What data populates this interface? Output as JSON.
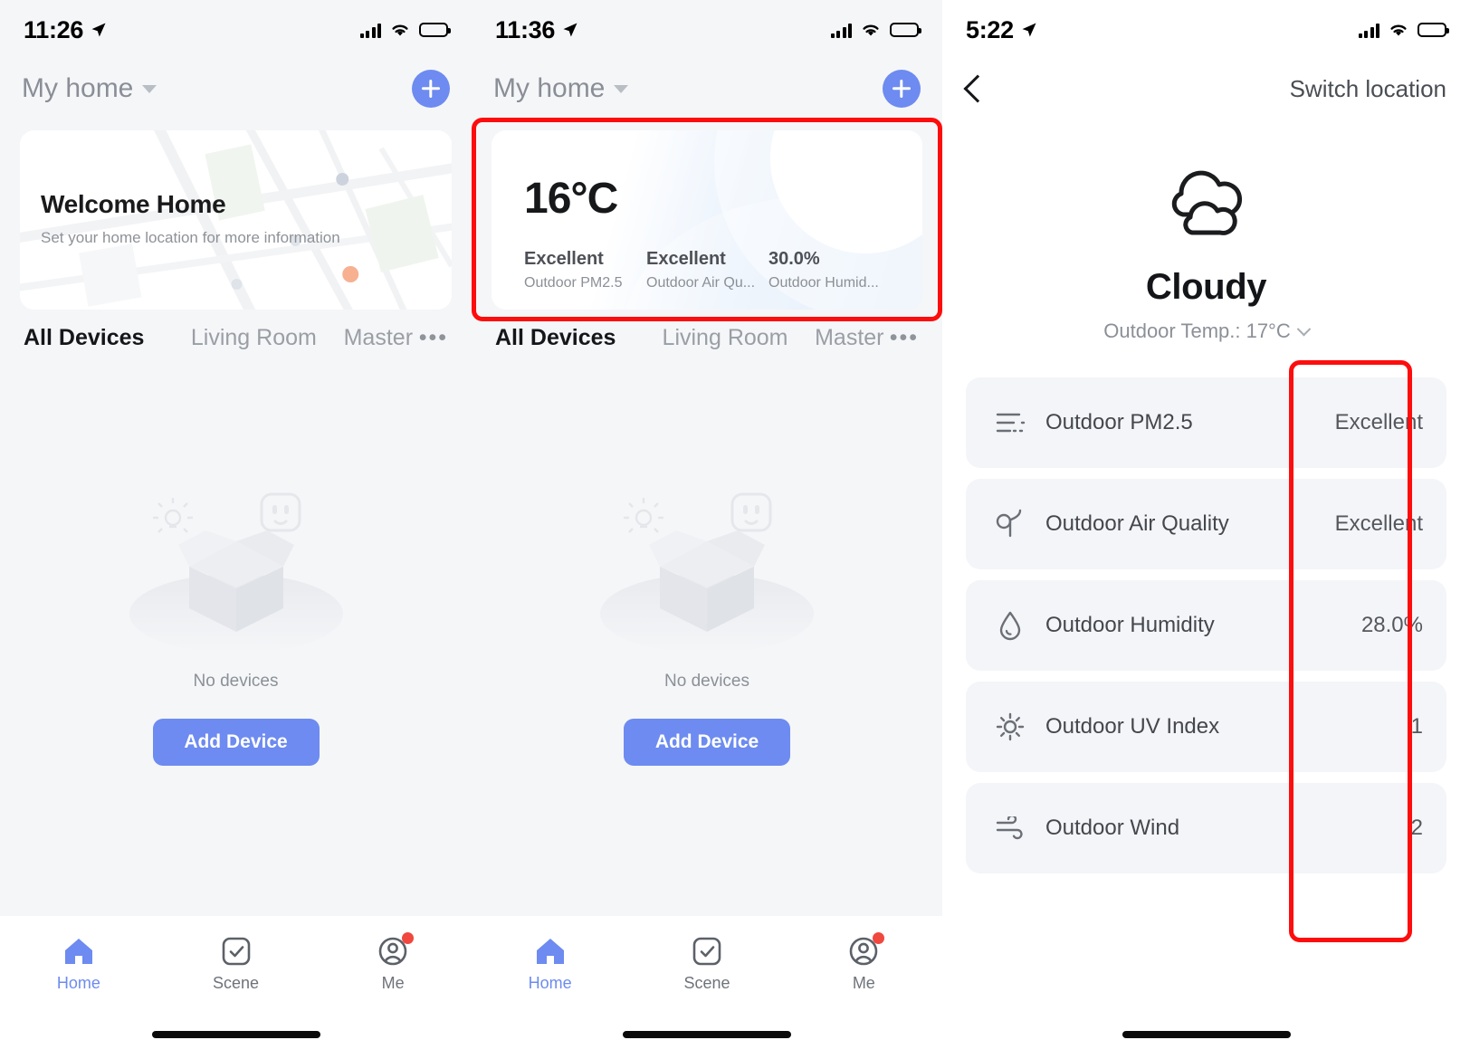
{
  "panel1": {
    "status": {
      "time": "11:26",
      "location_icon": "location-arrow-icon",
      "cellular_icon": "cellular-bars-icon",
      "wifi_icon": "wifi-icon",
      "battery_icon": "battery-icon"
    },
    "header": {
      "home_name": "My home",
      "caret_icon": "chevron-down-icon",
      "add_icon": "plus-icon"
    },
    "welcome": {
      "title": "Welcome Home",
      "subtitle": "Set your home location for more information"
    },
    "tabs": [
      {
        "label": "All Devices",
        "active": true
      },
      {
        "label": "Living Room",
        "active": false
      },
      {
        "label": "Master Be",
        "active": false
      }
    ],
    "tabs_overflow": "•••",
    "empty": {
      "message": "No devices",
      "button": "Add Device"
    },
    "tabbar": [
      {
        "label": "Home",
        "icon": "home-icon",
        "active": true,
        "badge": false
      },
      {
        "label": "Scene",
        "icon": "checkbox-icon",
        "active": false,
        "badge": false
      },
      {
        "label": "Me",
        "icon": "account-icon",
        "active": false,
        "badge": true
      }
    ]
  },
  "panel2": {
    "status": {
      "time": "11:36",
      "location_icon": "location-arrow-icon"
    },
    "header": {
      "home_name": "My home",
      "caret_icon": "chevron-down-icon",
      "add_icon": "plus-icon"
    },
    "weather_card": {
      "temperature": "16°C",
      "metrics": [
        {
          "value": "Excellent",
          "label": "Outdoor PM2.5"
        },
        {
          "value": "Excellent",
          "label": "Outdoor Air Qu..."
        },
        {
          "value": "30.0%",
          "label": "Outdoor Humid..."
        }
      ]
    },
    "tabs": [
      {
        "label": "All Devices",
        "active": true
      },
      {
        "label": "Living Room",
        "active": false
      },
      {
        "label": "Master Be",
        "active": false
      }
    ],
    "tabs_overflow": "•••",
    "empty": {
      "message": "No devices",
      "button": "Add Device"
    },
    "tabbar": [
      {
        "label": "Home",
        "icon": "home-icon",
        "active": true,
        "badge": false
      },
      {
        "label": "Scene",
        "icon": "checkbox-icon",
        "active": false,
        "badge": false
      },
      {
        "label": "Me",
        "icon": "account-icon",
        "active": false,
        "badge": true
      }
    ]
  },
  "panel3": {
    "status": {
      "time": "5:22",
      "location_icon": "location-arrow-icon"
    },
    "header": {
      "back_icon": "chevron-left-icon",
      "switch_location": "Switch location"
    },
    "weather": {
      "icon": "cloudy-icon",
      "condition": "Cloudy",
      "outdoor_temp": "Outdoor Temp.: 17°C",
      "temp_caret_icon": "chevron-down-icon"
    },
    "metrics": [
      {
        "icon": "pm25-icon",
        "label": "Outdoor PM2.5",
        "value": "Excellent"
      },
      {
        "icon": "leaf-icon",
        "label": "Outdoor Air Quality",
        "value": "Excellent"
      },
      {
        "icon": "droplet-icon",
        "label": "Outdoor Humidity",
        "value": "28.0%"
      },
      {
        "icon": "sun-icon",
        "label": "Outdoor UV Index",
        "value": "1"
      },
      {
        "icon": "wind-icon",
        "label": "Outdoor Wind",
        "value": "2"
      }
    ]
  },
  "annotations": {
    "highlight_color": "#fd0d0d",
    "boxes": [
      {
        "name": "weather-card-highlight",
        "panel": 2
      },
      {
        "name": "metric-values-highlight",
        "panel": 3
      }
    ]
  }
}
